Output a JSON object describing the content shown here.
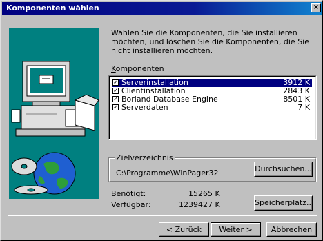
{
  "window": {
    "title": "Komponenten wählen",
    "close_label": "×"
  },
  "intro": "Wählen Sie die Komponenten, die Sie installieren möchten, und löschen Sie die Komponenten, die Sie nicht installieren möchten.",
  "components_label": "Komponenten",
  "components": [
    {
      "name": "Serverinstallation",
      "size": "3912 K",
      "checked": true,
      "selected": true
    },
    {
      "name": "Clientinstallation",
      "size": "2843 K",
      "checked": true,
      "selected": false
    },
    {
      "name": "Borland Database Engine",
      "size": "8501 K",
      "checked": true,
      "selected": false
    },
    {
      "name": "Serverdaten",
      "size": "7 K",
      "checked": true,
      "selected": false
    }
  ],
  "destination": {
    "label": "Zielverzeichnis",
    "path": "C:\\Programme\\WinPager32",
    "browse_label": "Durchsuchen..."
  },
  "space": {
    "required_label": "Benötigt:",
    "required_value": "15265 K",
    "available_label": "Verfügbar:",
    "available_value": "1239427 K",
    "disk_button_label": "Speicherplatz..."
  },
  "buttons": {
    "back": "< Zurück",
    "next": "Weiter >",
    "cancel": "Abbrechen"
  },
  "icons": [
    "computer-icon",
    "cd-discs-icon",
    "globe-icon",
    "checkbox-check-icon"
  ]
}
